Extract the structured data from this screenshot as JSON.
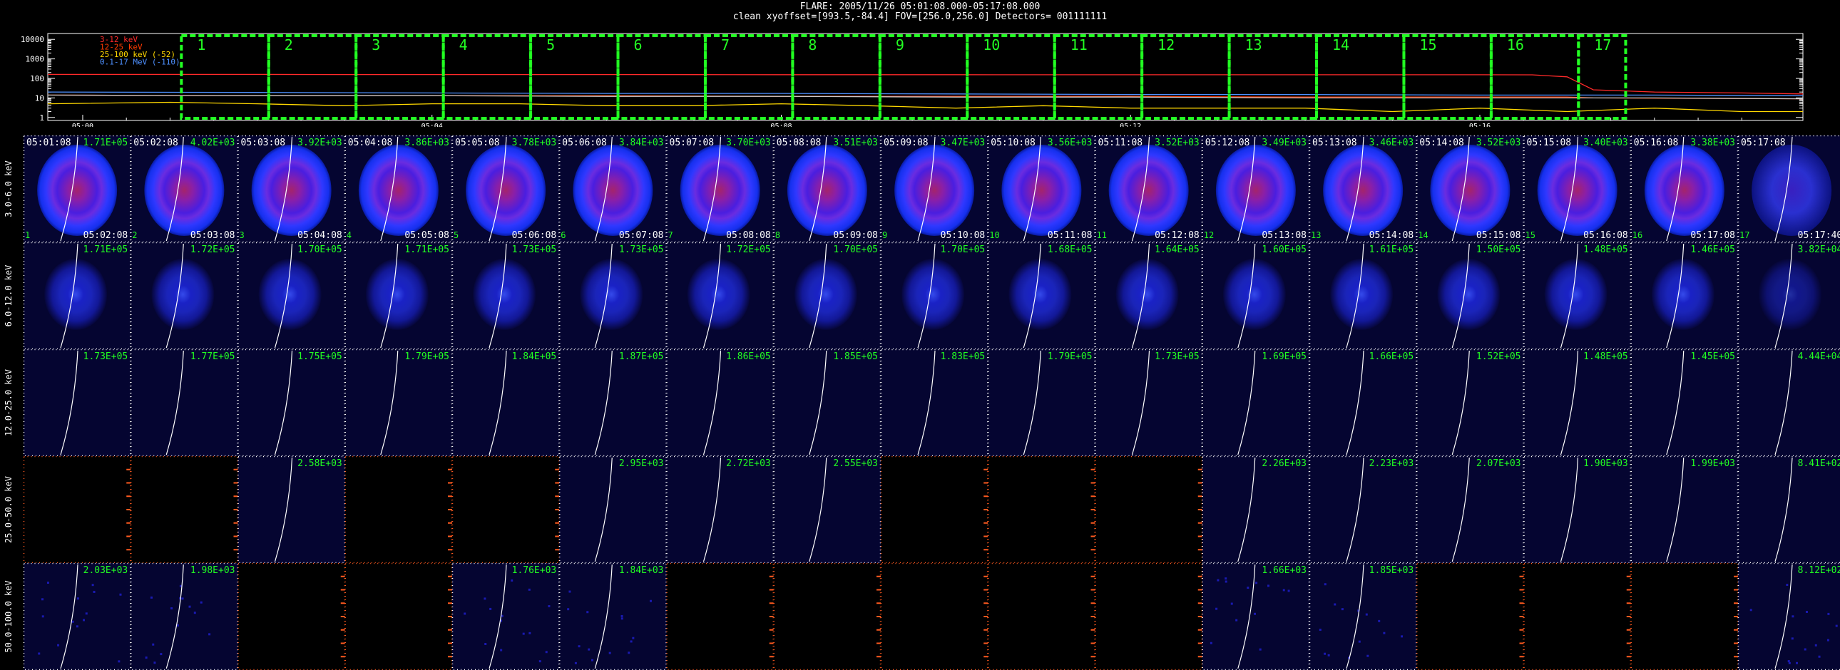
{
  "header": {
    "line1": "FLARE: 2005/11/26 05:01:08.000-05:17:08.000",
    "line2": "clean    xyoffset=[993.5,-84.4]    FOV=[256.0,256.0]    Detectors= 001111111"
  },
  "chart_data": [
    {
      "type": "line",
      "title": "",
      "ylog": true,
      "yticks": [
        "10000",
        "1000",
        "100",
        "10",
        "1"
      ],
      "ytick_values": [
        10000,
        1000,
        100,
        10,
        1
      ],
      "xticks": [
        "05:00",
        "05:04",
        "05:08",
        "05:12",
        "05:16"
      ],
      "xtick_minutes": [
        0,
        4,
        8,
        12,
        16
      ],
      "xlim_minutes": [
        -0.4,
        19.7
      ],
      "legend": [
        "3-12 keV",
        "12-25 keV",
        "25-100 keV (-52)",
        "0.1-17 MeV (-110)"
      ],
      "legend_colors": [
        "#ff2a2a",
        "#ff3a00",
        "#ffd800",
        "#4e90ff"
      ],
      "series": [
        {
          "name": "3-12 keV",
          "color": "#ff2a2a",
          "x": [
            -0.4,
            0,
            1,
            2,
            3,
            4,
            5,
            6,
            7,
            8,
            9,
            10,
            11,
            12,
            13,
            14,
            15,
            16,
            16.6,
            17,
            17.3,
            18,
            19,
            19.7
          ],
          "y": [
            160,
            160,
            160,
            160,
            158,
            158,
            158,
            157,
            156,
            155,
            155,
            155,
            154,
            154,
            154,
            154,
            154,
            154,
            152,
            120,
            26,
            20,
            18,
            16
          ]
        },
        {
          "name": "12-25 keV",
          "color": "#ff3a00",
          "x": [
            -0.4,
            2,
            4,
            6,
            8,
            10,
            12,
            14,
            16,
            17,
            17.3,
            19.7
          ],
          "y": [
            14,
            13,
            13,
            13,
            12,
            12,
            12,
            11,
            11,
            11,
            10,
            9
          ]
        },
        {
          "name": "25-100 keV (-52)",
          "color": "#ffd800",
          "x": [
            -0.4,
            1,
            2,
            3,
            4,
            5,
            6,
            7,
            8,
            9,
            10,
            11,
            12,
            13,
            14,
            15,
            16,
            17,
            18,
            19,
            19.7
          ],
          "y": [
            5,
            6,
            5,
            4,
            5,
            5,
            4,
            4,
            5,
            4,
            3,
            4,
            3,
            3,
            3,
            2,
            3,
            2,
            3,
            2,
            2
          ]
        },
        {
          "name": "0.1-17 MeV (-110)",
          "color": "#4e90ff",
          "x": [
            -0.4,
            2,
            4,
            6,
            8,
            10,
            12,
            14,
            16,
            18,
            19.7
          ],
          "y": [
            20,
            19,
            18,
            17,
            17,
            16,
            15,
            15,
            14,
            14,
            13
          ]
        },
        {
          "name": "",
          "color": "#c9c9c9",
          "x": [
            -0.4,
            2,
            4,
            6,
            8,
            10,
            12,
            14,
            16,
            18,
            19.7
          ],
          "y": [
            14,
            13,
            13,
            12,
            12,
            11,
            11,
            10,
            10,
            10,
            9
          ]
        }
      ],
      "intervals": [
        "1",
        "2",
        "3",
        "4",
        "5",
        "6",
        "7",
        "8",
        "9",
        "10",
        "11",
        "12",
        "13",
        "14",
        "15",
        "16",
        "17"
      ],
      "interval_minutes": [
        [
          1.13,
          2.13
        ],
        [
          2.13,
          3.13
        ],
        [
          3.13,
          4.13
        ],
        [
          4.13,
          5.13
        ],
        [
          5.13,
          6.13
        ],
        [
          6.13,
          7.13
        ],
        [
          7.13,
          8.13
        ],
        [
          8.13,
          9.13
        ],
        [
          9.13,
          10.13
        ],
        [
          10.13,
          11.13
        ],
        [
          11.13,
          12.13
        ],
        [
          12.13,
          13.13
        ],
        [
          13.13,
          14.13
        ],
        [
          14.13,
          15.13
        ],
        [
          15.13,
          16.13
        ],
        [
          16.13,
          17.13
        ],
        [
          17.13,
          17.67
        ]
      ],
      "interval_color": "#22ff22"
    },
    {
      "type": "heatmap",
      "title": "",
      "rows": [
        "3.0-6.0 keV",
        "6.0-12.0 keV",
        "12.0-25.0 keV",
        "25.0-50.0 keV",
        "50.0-100.0 keV"
      ],
      "start_times": [
        "05:01:08",
        "05:02:08",
        "05:03:08",
        "05:04:08",
        "05:05:08",
        "05:06:08",
        "05:07:08",
        "05:08:08",
        "05:09:08",
        "05:10:08",
        "05:11:08",
        "05:12:08",
        "05:13:08",
        "05:14:08",
        "05:15:08",
        "05:16:08",
        "05:17:08"
      ],
      "end_times": [
        "05:02:08",
        "05:03:08",
        "05:04:08",
        "05:05:08",
        "05:06:08",
        "05:07:08",
        "05:08:08",
        "05:09:08",
        "05:10:08",
        "05:11:08",
        "05:12:08",
        "05:13:08",
        "05:14:08",
        "05:15:08",
        "05:16:08",
        "05:17:08",
        "05:17:40"
      ],
      "numbers": [
        "1",
        "2",
        "3",
        "4",
        "5",
        "6",
        "7",
        "8",
        "9",
        "10",
        "11",
        "12",
        "13",
        "14",
        "15",
        "16",
        "17"
      ],
      "peaks": [
        [
          "1.71E+05",
          "4.02E+03",
          "3.92E+03",
          "3.86E+03",
          "3.78E+03",
          "3.84E+03",
          "3.70E+03",
          "3.51E+03",
          "3.47E+03",
          "3.56E+03",
          "3.52E+03",
          "3.49E+03",
          "3.46E+03",
          "3.52E+03",
          "3.40E+03",
          "3.38E+03",
          ""
        ],
        [
          "1.71E+05",
          "1.72E+05",
          "1.70E+05",
          "1.71E+05",
          "1.73E+05",
          "1.73E+05",
          "1.72E+05",
          "1.70E+05",
          "1.70E+05",
          "1.68E+05",
          "1.64E+05",
          "1.60E+05",
          "1.61E+05",
          "1.50E+05",
          "1.48E+05",
          "1.46E+05",
          "3.82E+04"
        ],
        [
          "1.73E+05",
          "1.77E+05",
          "1.75E+05",
          "1.79E+05",
          "1.84E+05",
          "1.87E+05",
          "1.86E+05",
          "1.85E+05",
          "1.83E+05",
          "1.79E+05",
          "1.73E+05",
          "1.69E+05",
          "1.66E+05",
          "1.52E+05",
          "1.48E+05",
          "1.45E+05",
          "4.44E+04"
        ],
        [
          "",
          "",
          "2.58E+03",
          "",
          "",
          "2.95E+03",
          "2.72E+03",
          "2.55E+03",
          "",
          "",
          "",
          "2.26E+03",
          "2.23E+03",
          "2.07E+03",
          "1.90E+03",
          "1.99E+03",
          "8.41E+02"
        ],
        [
          "2.03E+03",
          "1.98E+03",
          "",
          "",
          "1.76E+03",
          "1.84E+03",
          "",
          "",
          "",
          "",
          "",
          "1.66E+03",
          "1.85E+03",
          "",
          "",
          "",
          "8.12E+02"
        ]
      ],
      "images": [
        [
          "disk",
          "disk",
          "disk",
          "disk",
          "disk",
          "disk",
          "disk",
          "disk",
          "disk",
          "disk",
          "disk",
          "disk",
          "disk",
          "disk",
          "disk",
          "disk",
          "faint-disk"
        ],
        [
          "blob",
          "blob",
          "blob",
          "blob",
          "blob",
          "blob",
          "blob",
          "blob",
          "blob",
          "blob",
          "blob",
          "blob",
          "blob",
          "blob",
          "blob",
          "blob",
          "faint-blob"
        ],
        [
          "empty",
          "empty",
          "empty",
          "empty",
          "empty",
          "empty",
          "empty",
          "empty",
          "empty",
          "empty",
          "empty",
          "empty",
          "empty",
          "empty",
          "empty",
          "empty",
          "empty"
        ],
        [
          "none",
          "none",
          "empty",
          "none",
          "none",
          "empty",
          "empty",
          "empty",
          "none",
          "none",
          "none",
          "empty",
          "empty",
          "empty",
          "empty",
          "empty",
          "empty"
        ],
        [
          "noise",
          "noise",
          "none",
          "none",
          "noise",
          "noise",
          "none",
          "none",
          "none",
          "none",
          "none",
          "noise",
          "noise",
          "none",
          "none",
          "none",
          "noise"
        ]
      ],
      "colors": {
        "label": "#22ff22",
        "text": "#ffffff",
        "empty_bg": "#050531",
        "frame_valid": "#ffffff",
        "frame_invalid": "#ff5a1f"
      }
    }
  ]
}
